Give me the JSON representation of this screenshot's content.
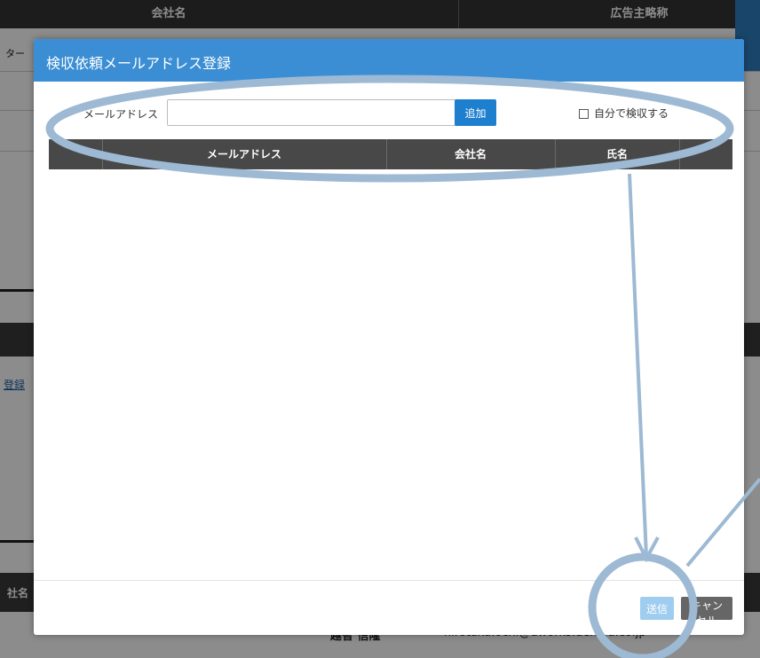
{
  "background": {
    "header_company": "会社名",
    "header_right": "広告主略称",
    "left_row_text": "ター",
    "left_link": "登録",
    "bottom_left_label": "社名",
    "bottom_name": "越智 信隆",
    "bottom_email": "hirotaku.ochi@dworks.dentsu.co.jp"
  },
  "modal": {
    "title": "検収依頼メールアドレス登録",
    "email_label": "メールアドレス",
    "email_value": "",
    "email_placeholder": "",
    "add_label": "追加",
    "self_inspect_label": "自分で検収する",
    "table_headers": [
      "",
      "メールアドレス",
      "会社名",
      "氏名",
      ""
    ],
    "rows": [],
    "send_label": "送信",
    "cancel_label": "キャンセル"
  },
  "colors": {
    "header_blue": "#3b8ed4",
    "add_button": "#1f7fcf",
    "send_button_disabled": "#9fcdef",
    "cancel_button": "#666666",
    "annotation": "#9db9d3"
  }
}
